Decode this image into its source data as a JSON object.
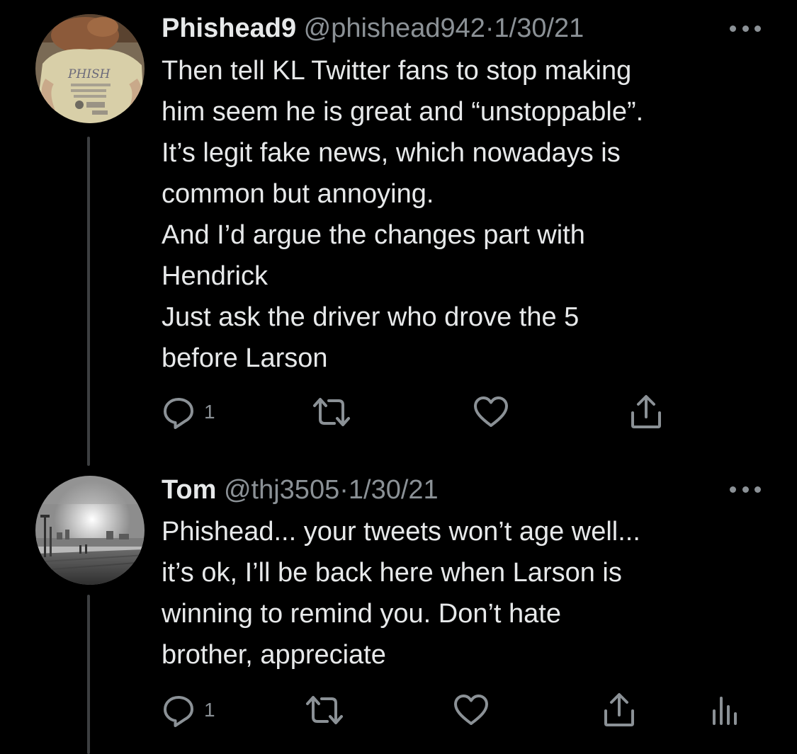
{
  "thread": [
    {
      "name": "Phishead9",
      "handle": "@phishead942",
      "separator": "·",
      "date": "1/30/21",
      "avatar_icon": "avatar-photo-shirt",
      "avatar_text": "PHISH",
      "body_lines": [
        "Then tell KL Twitter fans to stop making",
        "him seem he is great and “unstoppable”.",
        "It’s legit fake news, which nowadays is",
        "common but annoying.",
        "And I’d argue the changes part with",
        "Hendrick",
        "Just ask the driver who drove the 5",
        "before Larson"
      ],
      "reply_count": "1"
    },
    {
      "name": "Tom",
      "handle": "@thj3505",
      "separator": "·",
      "date": "1/30/21",
      "avatar_icon": "avatar-photo-waterfront",
      "body_lines": [
        "Phishead... your tweets won’t age well...",
        "it’s ok,  I’ll be back here when Larson is",
        "winning to remind you.  Don’t hate",
        "brother, appreciate"
      ],
      "reply_count": "1"
    }
  ],
  "colors": {
    "background": "#000000",
    "text": "#e7e9ea",
    "secondary": "#8b9196",
    "thread_line": "#3d3f41"
  }
}
